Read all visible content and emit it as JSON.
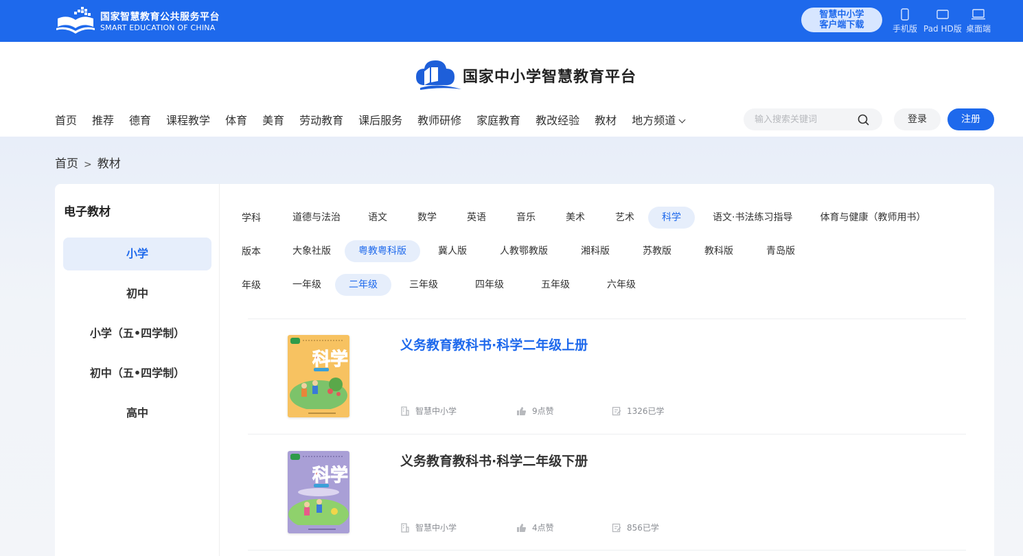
{
  "top_bar": {
    "logo_cn": "国家智慧教育公共服务平台",
    "logo_en": "SMART EDUCATION OF CHINA",
    "download_line1": "智慧中小学",
    "download_line2": "客户端下载",
    "devices": [
      {
        "label": "手机版",
        "icon": "phone-icon"
      },
      {
        "label": "Pad HD版",
        "icon": "tablet-icon"
      },
      {
        "label": "桌面端",
        "icon": "desktop-icon"
      }
    ]
  },
  "header": {
    "brand": "国家中小学智慧教育平台",
    "nav": [
      "首页",
      "推荐",
      "德育",
      "课程教学",
      "体育",
      "美育",
      "劳动教育",
      "课后服务",
      "教师研修",
      "家庭教育",
      "教改经验",
      "教材",
      "地方频道"
    ],
    "search_placeholder": "输入搜索关键词",
    "login": "登录",
    "register": "注册"
  },
  "breadcrumb": {
    "home": "首页",
    "sep": ">",
    "current": "教材"
  },
  "sidebar": {
    "title": "电子教材",
    "items": [
      "小学",
      "初中",
      "小学（五•四学制）",
      "初中（五•四学制）",
      "高中"
    ],
    "active_index": 0
  },
  "filters": {
    "subject": {
      "label": "学科",
      "options": [
        "道德与法治",
        "语文",
        "数学",
        "英语",
        "音乐",
        "美术",
        "艺术",
        "科学",
        "语文·书法练习指导",
        "体育与健康（教师用书）"
      ],
      "selected": "科学"
    },
    "edition": {
      "label": "版本",
      "options": [
        "大象社版",
        "粤教粤科版",
        "冀人版",
        "人教鄂教版",
        "湘科版",
        "苏教版",
        "教科版",
        "青岛版"
      ],
      "selected": "粤教粤科版"
    },
    "grade": {
      "label": "年级",
      "options": [
        "一年级",
        "二年级",
        "三年级",
        "四年级",
        "五年级",
        "六年级"
      ],
      "selected": "二年级"
    }
  },
  "books": [
    {
      "title": "义务教育教科书·科学二年级上册",
      "publisher": "智慧中小学",
      "likes": "9点赞",
      "learned": "1326已学",
      "cover_color": "#f7c261",
      "highlight": true
    },
    {
      "title": "义务教育教科书·科学二年级下册",
      "publisher": "智慧中小学",
      "likes": "4点赞",
      "learned": "856已学",
      "cover_color": "#a99fd6",
      "highlight": false
    }
  ],
  "colors": {
    "primary": "#1e69ec",
    "active_bg": "#e6eefb"
  }
}
